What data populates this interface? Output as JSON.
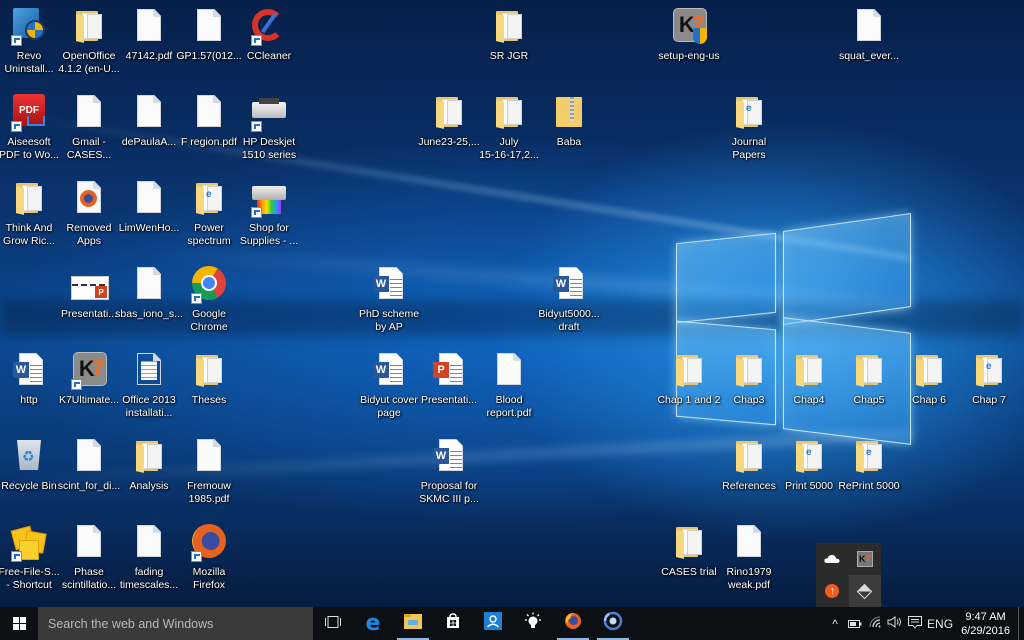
{
  "desktop": {
    "icons": [
      {
        "label": "Revo\nUninstall...",
        "type": "app-revo",
        "shortcut": true
      },
      {
        "label": "OpenOffice\n4.1.2 (en-U...",
        "type": "folder",
        "shortcut": false
      },
      {
        "label": "47142.pdf",
        "type": "document",
        "shortcut": false
      },
      {
        "label": "GP1.57(012...",
        "type": "document",
        "shortcut": false
      },
      {
        "label": "CCleaner",
        "type": "app-ccleaner",
        "shortcut": true
      },
      {
        "label": "Aiseesoft\nPDF to Wo...",
        "type": "app-aiseesoft",
        "shortcut": true
      },
      {
        "label": "Gmail -\nCASES...",
        "type": "document",
        "shortcut": false
      },
      {
        "label": "dePaulaA...",
        "type": "document",
        "shortcut": false
      },
      {
        "label": "F region.pdf",
        "type": "document",
        "shortcut": false
      },
      {
        "label": "HP Deskjet\n1510 series",
        "type": "app-printer",
        "shortcut": true
      },
      {
        "label": "Think And\nGrow Ric...",
        "type": "folder",
        "shortcut": false
      },
      {
        "label": "Removed\nApps",
        "type": "firefox-doc",
        "shortcut": false
      },
      {
        "label": "LimWenHo...",
        "type": "document",
        "shortcut": false
      },
      {
        "label": "Power\nspectrum",
        "type": "folder-pdf",
        "shortcut": false
      },
      {
        "label": "Shop for\nSupplies - ...",
        "type": "app-printer-color",
        "shortcut": true
      },
      {
        "label": "Presentati...",
        "type": "powerpoint-slide",
        "shortcut": false
      },
      {
        "label": "sbas_iono_s...",
        "type": "document",
        "shortcut": false
      },
      {
        "label": "Google\nChrome",
        "type": "app-chrome",
        "shortcut": true
      },
      {
        "label": "http",
        "type": "word",
        "shortcut": false
      },
      {
        "label": "K7Ultimate...",
        "type": "app-k7",
        "shortcut": true
      },
      {
        "label": "Office 2013\ninstallati...",
        "type": "document-lines",
        "shortcut": false
      },
      {
        "label": "Theses",
        "type": "folder",
        "shortcut": false
      },
      {
        "label": "Recycle Bin",
        "type": "recycle-bin",
        "shortcut": false
      },
      {
        "label": "scint_for_di...",
        "type": "document",
        "shortcut": false
      },
      {
        "label": "Analysis",
        "type": "folder",
        "shortcut": false
      },
      {
        "label": "Fremouw\n1985.pdf",
        "type": "document",
        "shortcut": false
      },
      {
        "label": "Free-File-S...\n- Shortcut",
        "type": "app-freefile",
        "shortcut": true
      },
      {
        "label": "Phase\nscintillatio...",
        "type": "document",
        "shortcut": false
      },
      {
        "label": "fading\ntimescales...",
        "type": "document",
        "shortcut": false
      },
      {
        "label": "Mozilla\nFirefox",
        "type": "app-firefox",
        "shortcut": true
      },
      {
        "label": "SR JGR",
        "type": "folder",
        "shortcut": false
      },
      {
        "label": "June23-25,...",
        "type": "folder",
        "shortcut": false
      },
      {
        "label": "July\n15-16-17,2...",
        "type": "folder",
        "shortcut": false
      },
      {
        "label": "Baba",
        "type": "zip-folder",
        "shortcut": false
      },
      {
        "label": "PhD scheme\nby AP",
        "type": "word",
        "shortcut": false
      },
      {
        "label": "Bidyut5000...\ndraft",
        "type": "word",
        "shortcut": false
      },
      {
        "label": "Bidyut cover\npage",
        "type": "word",
        "shortcut": false
      },
      {
        "label": "Presentati...",
        "type": "powerpoint",
        "shortcut": false
      },
      {
        "label": "Blood\nreport.pdf",
        "type": "document",
        "shortcut": false
      },
      {
        "label": "Proposal for\nSKMC III p...",
        "type": "word",
        "shortcut": false
      },
      {
        "label": "setup-eng-us",
        "type": "app-k7-setup",
        "shortcut": false
      },
      {
        "label": "squat_ever...",
        "type": "document",
        "shortcut": false
      },
      {
        "label": "Journal\nPapers",
        "type": "folder-pdf",
        "shortcut": false
      },
      {
        "label": "Chap 1 and 2",
        "type": "folder",
        "shortcut": false
      },
      {
        "label": "Chap3",
        "type": "folder",
        "shortcut": false
      },
      {
        "label": "Chap4",
        "type": "folder",
        "shortcut": false
      },
      {
        "label": "Chap5",
        "type": "folder",
        "shortcut": false
      },
      {
        "label": "Chap 6",
        "type": "folder",
        "shortcut": false
      },
      {
        "label": "Chap 7",
        "type": "folder-pdf",
        "shortcut": false
      },
      {
        "label": "References",
        "type": "folder",
        "shortcut": false
      },
      {
        "label": "Print 5000",
        "type": "folder-pdf",
        "shortcut": false
      },
      {
        "label": "RePrint 5000",
        "type": "folder-pdf",
        "shortcut": false
      },
      {
        "label": "CASES trial",
        "type": "folder",
        "shortcut": false
      },
      {
        "label": "Rino1979\nweak.pdf",
        "type": "document",
        "shortcut": false
      }
    ]
  },
  "taskbar": {
    "search_placeholder": "Search the web and Windows",
    "pinned": [
      {
        "name": "task-view",
        "active": false
      },
      {
        "name": "edge",
        "active": false
      },
      {
        "name": "file-explorer",
        "active": true
      },
      {
        "name": "store",
        "active": false
      },
      {
        "name": "people",
        "active": false
      },
      {
        "name": "tips",
        "active": false
      },
      {
        "name": "firefox",
        "active": true
      },
      {
        "name": "app-circular",
        "active": true
      }
    ],
    "tray": {
      "language": "ENG",
      "time": "9:47 AM",
      "date": "6/29/2016"
    }
  },
  "tray_overflow": {
    "items": [
      "onedrive",
      "k7-antivirus",
      "update-arrow",
      "diamond-app"
    ]
  },
  "colors": {
    "taskbar_bg": "#0c0f13",
    "search_bg": "#3a3a3a",
    "folder_yellow": "#e9c56a",
    "word_blue": "#2b579a",
    "ppt_red": "#d04423"
  }
}
